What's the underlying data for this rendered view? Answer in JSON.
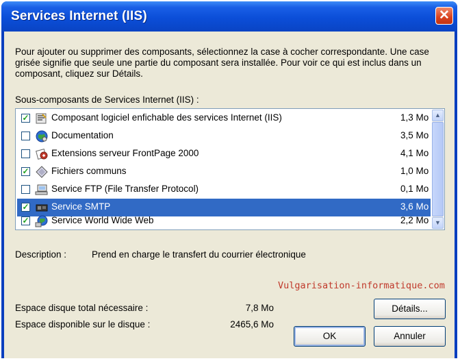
{
  "window": {
    "title": "Services Internet (IIS)",
    "close_glyph": "✕"
  },
  "intro_text": "Pour ajouter ou supprimer des composants, sélectionnez la case à cocher correspondante. Une case grisée signifie que seule une partie du composant sera installée. Pour voir ce qui est inclus dans un composant, cliquez sur Détails.",
  "list": {
    "label": "Sous-composants de Services Internet (IIS) :",
    "items": [
      {
        "label": "Composant logiciel enfichable des services Internet (IIS)",
        "size": "1,3 Mo",
        "checked": true,
        "icon": "snapin-icon"
      },
      {
        "label": "Documentation",
        "size": "3,5 Mo",
        "checked": false,
        "icon": "globe-doc-icon"
      },
      {
        "label": "Extensions serveur FrontPage 2000",
        "size": "4,1 Mo",
        "checked": false,
        "icon": "frontpage-icon"
      },
      {
        "label": "Fichiers communs",
        "size": "1,0 Mo",
        "checked": true,
        "icon": "common-files-icon"
      },
      {
        "label": "Service FTP (File Transfer Protocol)",
        "size": "0,1 Mo",
        "checked": false,
        "icon": "ftp-icon"
      },
      {
        "label": "Service SMTP",
        "size": "3,6 Mo",
        "checked": true,
        "icon": "smtp-icon",
        "selected": true
      },
      {
        "label": "Service World Wide Web",
        "size": "2,2 Mo",
        "checked": true,
        "icon": "www-icon"
      }
    ],
    "scroll_up_glyph": "▲",
    "scroll_down_glyph": "▼"
  },
  "description": {
    "label": "Description :",
    "text": "Prend en charge le transfert du courrier électronique"
  },
  "watermark": "Vulgarisation-informatique.com",
  "disk": {
    "total_label": "Espace disque total nécessaire :",
    "total_value": "7,8 Mo",
    "free_label": "Espace disponible sur le disque :",
    "free_value": "2465,6 Mo"
  },
  "buttons": {
    "details": "Détails...",
    "ok": "OK",
    "cancel": "Annuler"
  }
}
